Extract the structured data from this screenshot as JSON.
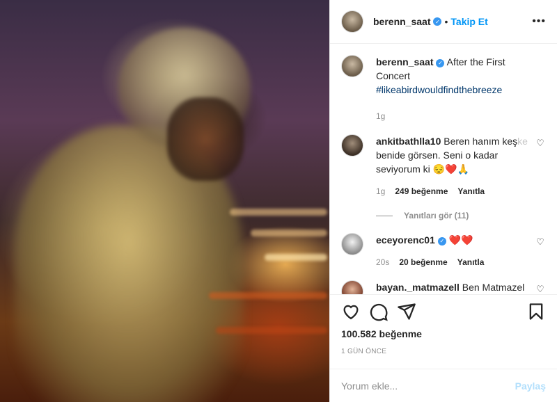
{
  "header": {
    "username": "berenn_saat",
    "follow_label": "Takip Et",
    "more_label": "•••"
  },
  "caption": {
    "username": "berenn_saat",
    "text": "After the First Concert",
    "hashtag": "#likeabirdwouldfindthebreeze",
    "time": "1g"
  },
  "comments": [
    {
      "username": "ankitbathlla10",
      "text": "Beren hanım keş",
      "text_fade": "ke",
      "text_rest": "benide görsen. Seni o kadar seviyorum ki 😔❤️🙏",
      "time": "1g",
      "likes": "249 beğenme",
      "reply": "Yanıtla",
      "view_replies": "Yanıtları gör (11)"
    },
    {
      "username": "eceyorenc01",
      "verified": true,
      "text": "❤️❤️",
      "time": "20s",
      "likes": "20 beğenme",
      "reply": "Yanıtla"
    },
    {
      "username": "bayan._matmazell",
      "text": "Ben Matmazel merhaba Bihter Hanım. Her bakımdan yetersiz 😂"
    }
  ],
  "footer": {
    "likes": "100.582 beğenme",
    "time": "1 GÜN ÖNCE",
    "comment_placeholder": "Yorum ekle...",
    "post_label": "Paylaş"
  },
  "icons": [
    "heart-icon",
    "comment-icon",
    "share-icon",
    "bookmark-icon"
  ],
  "colors": {
    "link_blue": "#0095f6",
    "verified_blue": "#3897f0",
    "muted": "#8e8e8e",
    "post_disabled": "#b2dffc"
  }
}
